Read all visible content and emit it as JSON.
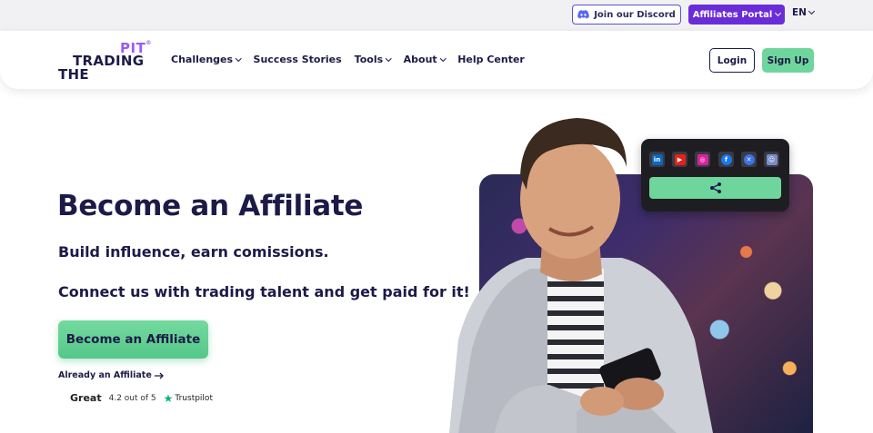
{
  "topbar": {
    "discord_label": "Join our Discord",
    "portal_label": "Affiliates Portal",
    "language": "EN"
  },
  "logo": {
    "line_pit": "PIT",
    "line_trading": "TRADING",
    "line_the": "THE"
  },
  "nav": {
    "items": [
      {
        "label": "Challenges",
        "dropdown": true
      },
      {
        "label": "Success Stories",
        "dropdown": false
      },
      {
        "label": "Tools",
        "dropdown": true
      },
      {
        "label": "About",
        "dropdown": true
      },
      {
        "label": "Help Center",
        "dropdown": false
      }
    ],
    "login_label": "Login",
    "signup_label": "Sign Up"
  },
  "hero": {
    "title": "Become an Affiliate",
    "subtitle1": "Build influence, earn comissions.",
    "subtitle2": "Connect us with trading talent and get paid for it!",
    "cta_label": "Become an Affiliate",
    "already_label": "Already an Affiliate",
    "trust_rating_word": "Great",
    "trust_score": "4.2 out of 5",
    "trust_brand": "Trustpilot"
  },
  "social_card": {
    "icons": [
      "linkedin-icon",
      "youtube-icon",
      "instagram-icon",
      "facebook-icon",
      "x-icon",
      "discord-icon"
    ],
    "share_icon": "share-icon"
  },
  "colors": {
    "navy": "#1c1a47",
    "purple": "#6a2cd8",
    "logo_purple": "#9a5cf0",
    "green": "#6ed69d"
  }
}
